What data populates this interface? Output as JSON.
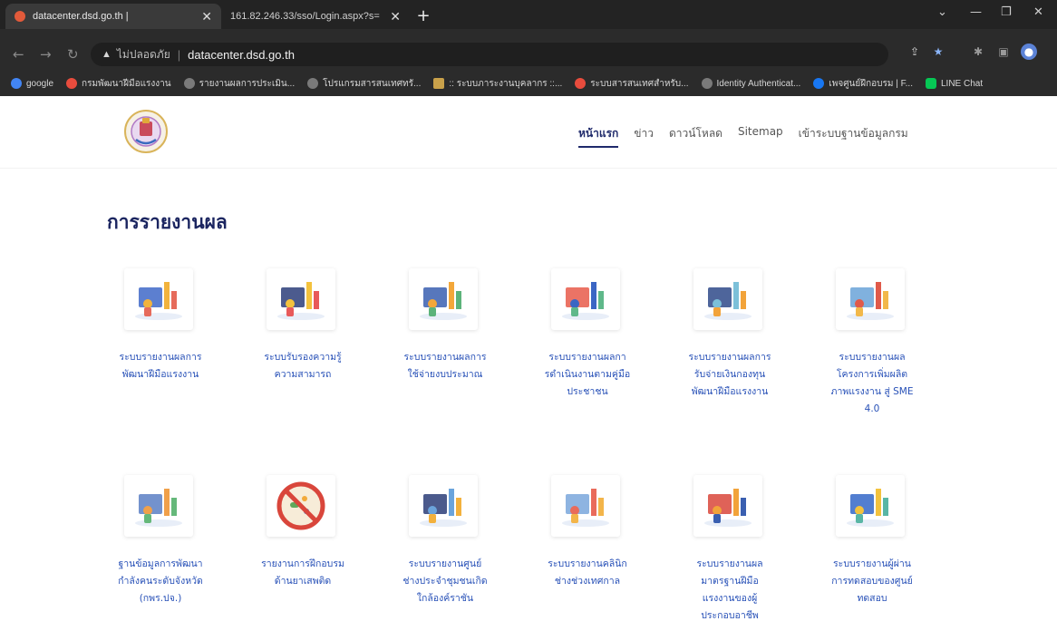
{
  "browser": {
    "tabs": [
      {
        "title": "datacenter.dsd.go.th |",
        "active": true
      },
      {
        "title": "161.82.246.33/sso/Login.aspx?s=",
        "active": false
      }
    ],
    "omnibox": {
      "insecure_label": "ไม่ปลอดภัย",
      "url": "datacenter.dsd.go.th"
    },
    "bookmarks": [
      {
        "label": "google",
        "color": "#4285f4"
      },
      {
        "label": "กรมพัฒนาฝีมือแรงงาน",
        "color": "#e84c3d"
      },
      {
        "label": "รายงานผลการประเมิน...",
        "color": "#7a7a7a"
      },
      {
        "label": "โปรแกรมสารสนเทศทรั...",
        "color": "#7a7a7a"
      },
      {
        "label": ":: ระบบภาระงานบุคลากร ::...",
        "color": "#c9a14a"
      },
      {
        "label": "ระบบสารสนเทศสำหรับ...",
        "color": "#e84c3d"
      },
      {
        "label": "Identity Authenticat...",
        "color": "#7a7a7a"
      },
      {
        "label": "เพจศูนย์ฝึกอบรม | F...",
        "color": "#1877f2"
      },
      {
        "label": "LINE Chat",
        "color": "#06c755"
      }
    ]
  },
  "site": {
    "nav": [
      {
        "label": "หน้าแรก",
        "active": true
      },
      {
        "label": "ข่าว",
        "active": false
      },
      {
        "label": "ดาวน์โหลด",
        "active": false
      },
      {
        "label": "Sitemap",
        "active": false
      },
      {
        "label": "เข้าระบบฐานข้อมูลกรม",
        "active": false
      }
    ],
    "section_title": "การรายงานผล",
    "cards": [
      {
        "lines": [
          "ระบบรายงานผลการ",
          "พัฒนาฝีมือแรงงาน"
        ],
        "icon": "chart-analysis-icon"
      },
      {
        "lines": [
          "ระบบรับรองความรู้",
          "ความสามารถ"
        ],
        "icon": "certificate-books-icon"
      },
      {
        "lines": [
          "ระบบรายงานผลการ",
          "ใช้จ่ายงบประมาณ"
        ],
        "icon": "budget-team-icon"
      },
      {
        "lines": [
          "ระบบรายงานผลกา",
          "รดำเนินงานตามคู่มือ",
          "ประชาชน"
        ],
        "icon": "presentation-icon"
      },
      {
        "lines": [
          "ระบบรายงานผลการ",
          "รับจ่ายเงินกองทุน",
          "พัฒนาฝีมือแรงงาน"
        ],
        "icon": "fund-growth-icon"
      },
      {
        "lines": [
          "ระบบรายงานผล",
          "โครงการเพิ่มผลิต",
          "ภาพแรงงาน สู่ SME",
          "4.0"
        ],
        "icon": "teamwork-desk-icon"
      },
      {
        "lines": [
          "ฐานข้อมูลการพัฒนา",
          "กำลังคนระดับจังหวัด",
          "(กพร.ปจ.)"
        ],
        "icon": "meeting-icon"
      },
      {
        "lines": [
          "รายงานการฝึกอบรม",
          "ด้านยาเสพติด"
        ],
        "icon": "no-drugs-icon"
      },
      {
        "lines": [
          "ระบบรายงานศูนย์",
          "ช่างประจำชุมชนเกิด",
          "ใกล้องค์ราชัน"
        ],
        "icon": "repair-tools-icon"
      },
      {
        "lines": [
          "ระบบรายงานคลินิก",
          "ช่างช่วงเทศกาล"
        ],
        "icon": "clinic-board-icon"
      },
      {
        "lines": [
          "ระบบรายงานผล",
          "มาตรฐานฝีมือ",
          "แรงงานของผู้",
          "ประกอบอาชีพ"
        ],
        "icon": "standard-puzzle-icon"
      },
      {
        "lines": [
          "ระบบรายงานผู้ผ่าน",
          "การทดสอบของศูนย์",
          "ทดสอบ"
        ],
        "icon": "test-screen-icon"
      }
    ]
  }
}
